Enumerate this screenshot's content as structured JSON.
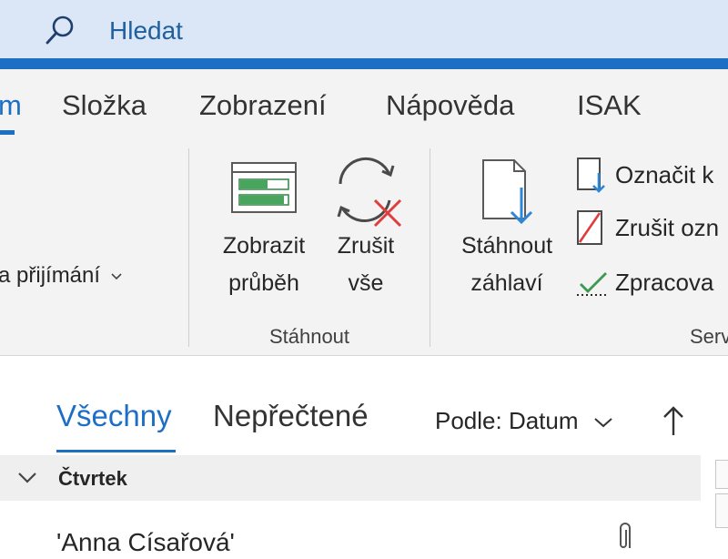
{
  "search": {
    "label": "Hledat"
  },
  "ribbon": {
    "tabs": [
      {
        "label": "m",
        "active": true
      },
      {
        "label": "Složka"
      },
      {
        "label": "Zobrazení"
      },
      {
        "label": "Nápověda"
      },
      {
        "label": "ISAK"
      }
    ],
    "receive_options_label": "a přijímání",
    "download_group": {
      "label": "Stáhnout",
      "show_progress": {
        "line1": "Zobrazit",
        "line2": "průběh"
      },
      "cancel_all": {
        "line1": "Zrušit",
        "line2": "vše"
      }
    },
    "server_group": {
      "label": "Serv",
      "download_headers": {
        "line1": "Stáhnout",
        "line2": "záhlaví"
      },
      "mark_label": "Označit k",
      "unmark_label": "Zrušit ozn",
      "process_label": "Zpracova"
    }
  },
  "mail_list": {
    "filters": [
      {
        "label": "Všechny",
        "active": true
      },
      {
        "label": "Nepřečtené"
      }
    ],
    "sort_label": "Podle: Datum",
    "group_title": "Čtvrtek",
    "first_sender": "'Anna Císařová'"
  },
  "colors": {
    "accent": "#1d6ec5",
    "search_bg": "#dbe7f6",
    "ribbon_bg": "#f3f3f3"
  }
}
